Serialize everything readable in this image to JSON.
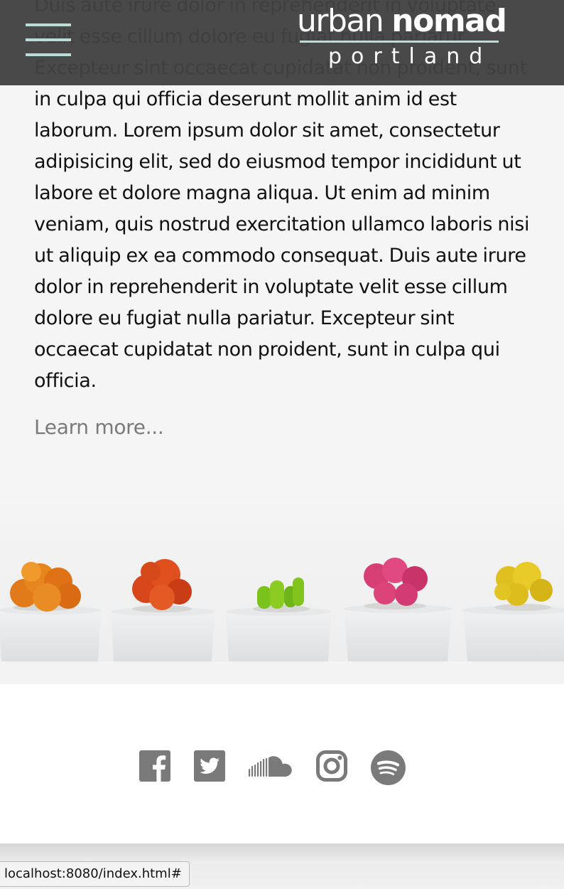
{
  "main": {
    "body_text": "Duis aute irure dolor in reprehenderit in voluptate velit esse cillum dolore eu fugiat nulla pariatur. Excepteur sint occaecat cupidatat non proident, sunt in culpa qui officia deserunt mollit anim id est laborum. Lorem ipsum dolor sit amet, consectetur adipisicing elit, sed do eiusmod tempor incididunt ut labore et dolore magna aliqua. Ut enim ad minim veniam, quis nostrud exercitation ullamco laboris nisi ut aliquip ex ea commodo consequat. Duis aute irure dolor in reprehenderit in voluptate velit esse cillum dolore eu fugiat nulla pariatur. Excepteur sint occaecat cupidatat non proident, sunt in culpa qui officia.",
    "learn_more_label": "Learn more..."
  },
  "header": {
    "logo_light": "urban",
    "logo_bold": "nomad",
    "logo_sub": "portland",
    "menu_icon": "hamburger-menu-icon"
  },
  "footer": {
    "social_icons": [
      "facebook-icon",
      "twitter-icon",
      "soundcloud-icon",
      "instagram-icon",
      "spotify-icon"
    ]
  },
  "status_bar": {
    "url": "localhost:8080/index.html#"
  },
  "colors": {
    "header_bg": "#424242",
    "accent": "#b8ddd9",
    "icon_gray": "#7a7a7a",
    "page_bg": "#f5f5f5"
  }
}
